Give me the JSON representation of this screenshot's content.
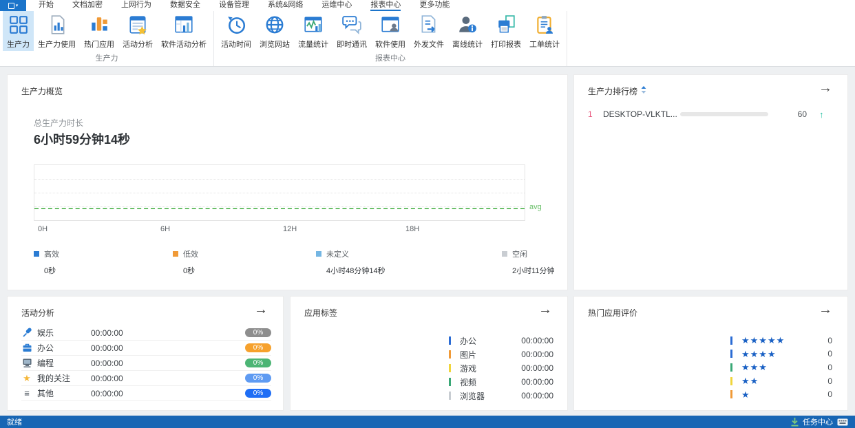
{
  "menubar": {
    "tabs": [
      {
        "label": "开始",
        "active": false
      },
      {
        "label": "文档加密",
        "active": false
      },
      {
        "label": "上网行为",
        "active": false
      },
      {
        "label": "数据安全",
        "active": false
      },
      {
        "label": "设备管理",
        "active": false
      },
      {
        "label": "系统&网络",
        "active": false
      },
      {
        "label": "运维中心",
        "active": false
      },
      {
        "label": "报表中心",
        "active": true
      },
      {
        "label": "更多功能",
        "active": false
      }
    ]
  },
  "ribbon": {
    "groups": [
      {
        "label": "生产力",
        "buttons": [
          {
            "label": "生产力",
            "icon": "productivity-grid-icon",
            "active": true
          },
          {
            "label": "生产力使用",
            "icon": "productivity-usage-icon",
            "active": false
          },
          {
            "label": "热门应用",
            "icon": "hot-apps-icon",
            "active": false
          },
          {
            "label": "活动分析",
            "icon": "activity-analysis-icon",
            "active": false
          },
          {
            "label": "软件活动分析",
            "icon": "software-activity-icon",
            "active": false
          }
        ]
      },
      {
        "label": "报表中心",
        "buttons": [
          {
            "label": "活动时间",
            "icon": "activity-time-icon",
            "active": false
          },
          {
            "label": "浏览网站",
            "icon": "browse-web-icon",
            "active": false
          },
          {
            "label": "流量统计",
            "icon": "traffic-stats-icon",
            "active": false
          },
          {
            "label": "即时通讯",
            "icon": "instant-message-icon",
            "active": false
          },
          {
            "label": "软件使用",
            "icon": "software-usage-icon",
            "active": false
          },
          {
            "label": "外发文件",
            "icon": "outgoing-files-icon",
            "active": false
          },
          {
            "label": "离线统计",
            "icon": "offline-stats-icon",
            "active": false
          },
          {
            "label": "打印报表",
            "icon": "print-report-icon",
            "active": false
          },
          {
            "label": "工单统计",
            "icon": "ticket-stats-icon",
            "active": false
          }
        ]
      }
    ]
  },
  "overview": {
    "title": "生产力概览",
    "total_label": "总生产力时长",
    "total_value": "6小时59分钟14秒",
    "chart_data": {
      "type": "line",
      "x_ticks": [
        "0H",
        "6H",
        "12H",
        "18H"
      ],
      "x_range": [
        "0H",
        "24H"
      ],
      "series": [],
      "avg_label": "avg",
      "avg_color": "#6abf69",
      "grid": true
    },
    "legend": [
      {
        "label": "高效",
        "value": "0秒",
        "color": "#2b7cd3"
      },
      {
        "label": "低效",
        "value": "0秒",
        "color": "#f09a37"
      },
      {
        "label": "未定义",
        "value": "4小时48分钟14秒",
        "color": "#74b6e3"
      },
      {
        "label": "空闲",
        "value": "2小时11分钟",
        "color": "#c9cdd2"
      }
    ]
  },
  "ranking": {
    "title": "生产力排行榜",
    "rows": [
      {
        "rank": "1",
        "name": "DESKTOP-VLKTL...",
        "value": "60",
        "trend": "↑",
        "fill": "68%"
      }
    ]
  },
  "activity": {
    "title": "活动分析",
    "rows": [
      {
        "icon": "microphone-icon",
        "label": "娱乐",
        "time": "00:00:00",
        "percent": "0%",
        "badge_color": "#8e8e8e"
      },
      {
        "icon": "briefcase-icon",
        "label": "办公",
        "time": "00:00:00",
        "percent": "0%",
        "badge_color": "#f6a12d"
      },
      {
        "icon": "monitor-icon",
        "label": "编程",
        "time": "00:00:00",
        "percent": "0%",
        "badge_color": "#4cb575"
      },
      {
        "icon": "star-icon",
        "label": "我的关注",
        "time": "00:00:00",
        "percent": "0%",
        "badge_color": "#5f9bf2"
      },
      {
        "icon": "menu-lines-icon",
        "label": "其他",
        "time": "00:00:00",
        "percent": "0%",
        "badge_color": "#1f6ef5"
      }
    ]
  },
  "app_tags": {
    "title": "应用标签",
    "rows": [
      {
        "label": "办公",
        "time": "00:00:00",
        "color": "#2b6cd4"
      },
      {
        "label": "图片",
        "time": "00:00:00",
        "color": "#f09a37"
      },
      {
        "label": "游戏",
        "time": "00:00:00",
        "color": "#f0d53c"
      },
      {
        "label": "视频",
        "time": "00:00:00",
        "color": "#3aa876"
      },
      {
        "label": "浏览器",
        "time": "00:00:00",
        "color": "#c8cdd2"
      }
    ]
  },
  "ratings": {
    "title": "热门应用评价",
    "rows": [
      {
        "stars": "★★★★★",
        "count": "0",
        "color": "#2b6cd4"
      },
      {
        "stars": "★★★★",
        "count": "0",
        "color": "#2b6cd4"
      },
      {
        "stars": "★★★",
        "count": "0",
        "color": "#3aa876"
      },
      {
        "stars": "★★",
        "count": "0",
        "color": "#f0d53c"
      },
      {
        "stars": "★",
        "count": "0",
        "color": "#f09a37"
      }
    ]
  },
  "statusbar": {
    "left_text": "就绪",
    "task_center_label": "任务中心"
  }
}
